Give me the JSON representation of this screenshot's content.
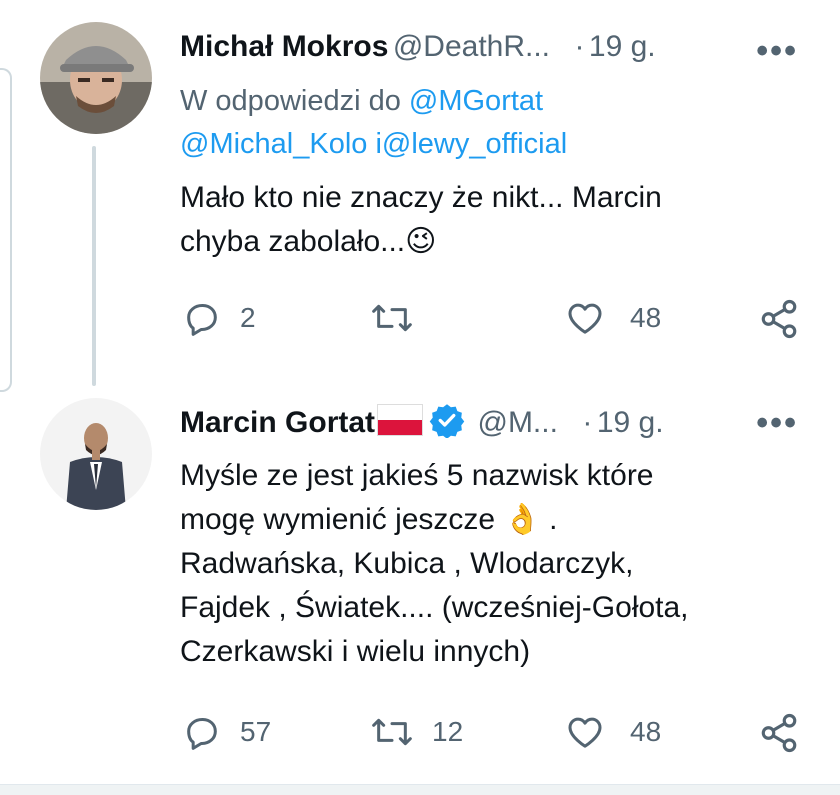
{
  "tweets": [
    {
      "name": "Michał Mokros",
      "handle": "@DeathR...",
      "separator": "·",
      "age": "19 g.",
      "more": "•••",
      "reply_prefix": "W odpowiedzi do ",
      "reply_mention_1": "@MGortat",
      "reply_mention_2": "@Michal_Kolo",
      "reply_joiner": " i",
      "reply_mention_3": "@lewy_official",
      "text_line_1": "Mało kto nie znaczy że nikt... Marcin",
      "text_line_2": "chyba zabolało...",
      "emoji": "😉",
      "replies": "2",
      "retweets": "",
      "likes": "48"
    },
    {
      "name": "Marcin Gortat",
      "handle": "@M...",
      "separator": "·",
      "age": "19 g.",
      "more": "•••",
      "flag_colors": [
        "#ffffff",
        "#dc143c"
      ],
      "verified_color": "#1d9bf0",
      "text_line_1": "Myśle ze jest jakieś 5 nazwisk które",
      "text_line_2": "mogę wymienić jeszcze",
      "emoji": "👌",
      "text_line_2_end": ".",
      "text_line_3": "Radwańska, Kubica , Wlodarczyk,",
      "text_line_4": "Fajdek , Światek.... (wcześniej-Gołota,",
      "text_line_5": "Czerkawski i wielu innych)",
      "replies": "57",
      "retweets": "12",
      "likes": "48"
    }
  ],
  "icons": {
    "reply": "reply-icon",
    "retweet": "retweet-icon",
    "like": "heart-icon",
    "share": "share-icon",
    "more": "more-icon"
  }
}
